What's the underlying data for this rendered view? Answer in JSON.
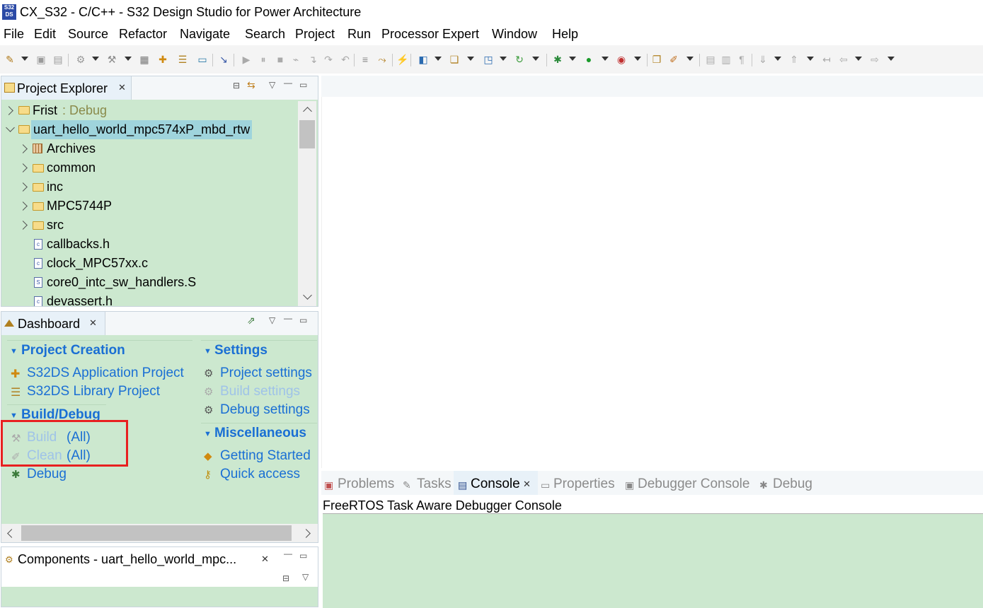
{
  "window": {
    "title": "CX_S32 - C/C++ - S32 Design Studio for Power Architecture",
    "icon": "s32ds-app-icon"
  },
  "menu": [
    "File",
    "Edit",
    "Source",
    "Refactor",
    "Navigate",
    "Search",
    "Project",
    "Run",
    "Processor Expert",
    "Window",
    "Help"
  ],
  "project_explorer": {
    "tab_label": "Project Explorer",
    "items": [
      {
        "name": "Frist",
        "suffix": ": Debug",
        "expanded": false,
        "type": "project"
      },
      {
        "name": "uart_hello_world_mpc574xP_mbd_rtw",
        "expanded": true,
        "selected": true,
        "type": "project"
      },
      {
        "name": "Archives",
        "type": "archives"
      },
      {
        "name": "common",
        "type": "folder"
      },
      {
        "name": "inc",
        "type": "folder"
      },
      {
        "name": "MPC5744P",
        "type": "folder"
      },
      {
        "name": "src",
        "type": "folder"
      },
      {
        "name": "callbacks.h",
        "type": "file",
        "glyph": "c"
      },
      {
        "name": "clock_MPC57xx.c",
        "type": "file",
        "glyph": "c"
      },
      {
        "name": "core0_intc_sw_handlers.S",
        "type": "file",
        "glyph": "S"
      },
      {
        "name": "devassert.h",
        "type": "file",
        "glyph": "c"
      }
    ]
  },
  "dashboard": {
    "tab_label": "Dashboard",
    "project_creation": {
      "heading": "Project Creation",
      "items": [
        "S32DS Application Project",
        "S32DS Library Project"
      ]
    },
    "build_debug": {
      "heading": "Build/Debug",
      "build": "Build",
      "clean": "Clean",
      "all": "(All)",
      "debug": "Debug"
    },
    "settings": {
      "heading": "Settings",
      "items": [
        "Project settings",
        "Build settings",
        "Debug settings"
      ]
    },
    "misc": {
      "heading": "Miscellaneous",
      "items": [
        "Getting Started",
        "Quick access"
      ]
    }
  },
  "components": {
    "tab_label": "Components - uart_hello_world_mpc..."
  },
  "bottom_tabs": [
    "Problems",
    "Tasks",
    "Console",
    "Properties",
    "Debugger Console",
    "Debug"
  ],
  "console": {
    "header": "FreeRTOS Task Aware Debugger Console"
  },
  "colors": {
    "green_bg": "#cce8cf",
    "link": "#1a6fd4",
    "selected": "#9fd4dc",
    "highlight_box": "#e82020"
  }
}
